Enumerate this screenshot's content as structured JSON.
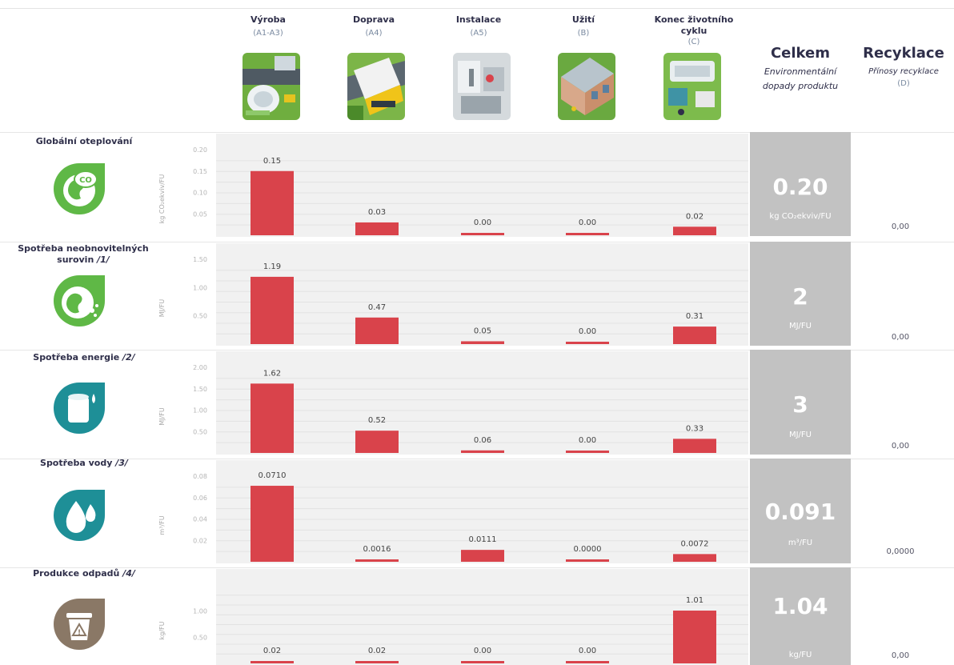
{
  "phases": [
    {
      "name": "Výroba",
      "code": "(A1-A3)"
    },
    {
      "name": "Doprava",
      "code": "(A4)"
    },
    {
      "name": "Instalace",
      "code": "(A5)"
    },
    {
      "name": "Užití",
      "code": "(B)"
    },
    {
      "name": "Konec životního cyklu",
      "code": "(C)"
    }
  ],
  "total_header": {
    "title": "Celkem",
    "subtitle": "Environmentální dopady produktu"
  },
  "recycling_header": {
    "title": "Recyklace",
    "subtitle": "Přínosy recyklace",
    "code": "(D)"
  },
  "icons": [
    "co2-globe-icon",
    "globe-resources-icon",
    "energy-barrel-icon",
    "water-drop-icon",
    "waste-bin-icon"
  ],
  "colors": {
    "bar": "#d9434b",
    "panel": "#f1f1f1",
    "total": "#c2c2c2",
    "green": "#5fb846",
    "teal": "#1e8f97",
    "brown": "#8a7866"
  },
  "chart_data": [
    {
      "type": "bar",
      "title": "Globální oteplování",
      "ylabel": "kg CO₂ekviv/FU",
      "ylim": [
        0,
        0.2
      ],
      "yticks": [
        "0.20",
        "0.15",
        "0.10",
        "0.05"
      ],
      "categories": [
        "Výroba",
        "Doprava",
        "Instalace",
        "Užití",
        "Konec životního cyklu"
      ],
      "values": [
        0.15,
        0.03,
        0.0,
        0.0,
        0.02
      ],
      "value_labels": [
        "0.15",
        "0.03",
        "0.00",
        "0.00",
        "0.02"
      ],
      "total": "0.20",
      "total_unit": "kg CO₂ekviv/FU",
      "recycling": "0,00"
    },
    {
      "type": "bar",
      "title": "Spotřeba neobnovitelných surovin",
      "footnote": "/1/",
      "ylabel": "MJ/FU",
      "ylim": [
        0,
        1.5
      ],
      "yticks": [
        "1.50",
        "1.00",
        "0.50"
      ],
      "categories": [
        "Výroba",
        "Doprava",
        "Instalace",
        "Užití",
        "Konec životního cyklu"
      ],
      "values": [
        1.19,
        0.47,
        0.05,
        0.0,
        0.31
      ],
      "value_labels": [
        "1.19",
        "0.47",
        "0.05",
        "0.00",
        "0.31"
      ],
      "total": "2",
      "total_unit": "MJ/FU",
      "recycling": "0,00"
    },
    {
      "type": "bar",
      "title": "Spotřeba energie",
      "footnote": "/2/",
      "ylabel": "MJ/FU",
      "ylim": [
        0,
        2.0
      ],
      "yticks": [
        "2.00",
        "1.50",
        "1.00",
        "0.50"
      ],
      "categories": [
        "Výroba",
        "Doprava",
        "Instalace",
        "Užití",
        "Konec životního cyklu"
      ],
      "values": [
        1.62,
        0.52,
        0.06,
        0.0,
        0.33
      ],
      "value_labels": [
        "1.62",
        "0.52",
        "0.06",
        "0.00",
        "0.33"
      ],
      "total": "3",
      "total_unit": "MJ/FU",
      "recycling": "0,00"
    },
    {
      "type": "bar",
      "title": "Spotřeba vody",
      "footnote": "/3/",
      "ylabel": "m³/FU",
      "ylim": [
        0,
        0.08
      ],
      "yticks": [
        "0.08",
        "0.06",
        "0.04",
        "0.02"
      ],
      "categories": [
        "Výroba",
        "Doprava",
        "Instalace",
        "Užití",
        "Konec životního cyklu"
      ],
      "values": [
        0.071,
        0.0016,
        0.0111,
        0.0,
        0.0072
      ],
      "value_labels": [
        "0.0710",
        "0.0016",
        "0.0111",
        "0.0000",
        "0.0072"
      ],
      "total": "0.091",
      "total_unit": "m³/FU",
      "recycling": "0,0000"
    },
    {
      "type": "bar",
      "title": "Produkce odpadů",
      "footnote": "/4/",
      "ylabel": "kg/FU",
      "ylim": [
        0,
        1.5
      ],
      "yticks": [
        "1.00",
        "0.50"
      ],
      "categories": [
        "Výroba",
        "Doprava",
        "Instalace",
        "Užití",
        "Konec životního cyklu"
      ],
      "values": [
        0.02,
        0.02,
        0.0,
        0.0,
        1.01
      ],
      "value_labels": [
        "0.02",
        "0.02",
        "0.00",
        "0.00",
        "1.01"
      ],
      "total": "1.04",
      "total_unit": "kg/FU",
      "recycling": "0,00"
    }
  ]
}
